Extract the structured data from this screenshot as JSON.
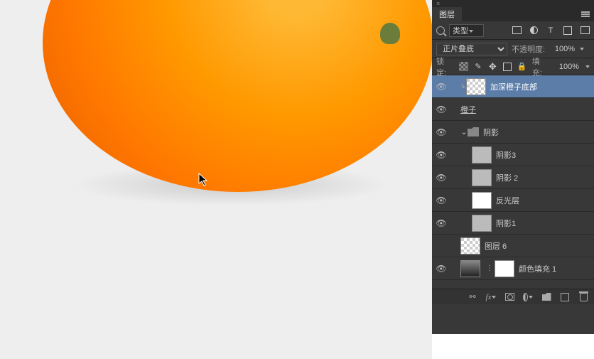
{
  "panel": {
    "tab": "图层",
    "filter": {
      "type_label": "类型"
    },
    "blend": {
      "mode": "正片叠底",
      "opacity_label": "不透明度:",
      "opacity": "100%"
    },
    "lock": {
      "label": "锁定:",
      "fill_label": "填充:",
      "fill": "100%"
    },
    "layers": [
      {
        "name": "加深橙子底部",
        "visible": true,
        "selected": true,
        "thumb": "check",
        "clip": true
      },
      {
        "name": "橙子",
        "visible": true,
        "thumb": "orange",
        "underline": true
      },
      {
        "name": "阴影",
        "visible": true,
        "folder": true,
        "expanded": true
      },
      {
        "name": "阴影3",
        "visible": true,
        "thumb": "gray",
        "indent": 2
      },
      {
        "name": "阴影 2",
        "visible": true,
        "thumb": "gray",
        "indent": 2
      },
      {
        "name": "反光层",
        "visible": true,
        "thumb": "white",
        "indent": 2
      },
      {
        "name": "阴影1",
        "visible": true,
        "thumb": "gray",
        "indent": 2
      },
      {
        "name": "图层 6",
        "visible": false,
        "thumb": "check"
      },
      {
        "name": "颜色填充 1",
        "visible": true,
        "thumb": "grad",
        "mask": true
      }
    ]
  }
}
